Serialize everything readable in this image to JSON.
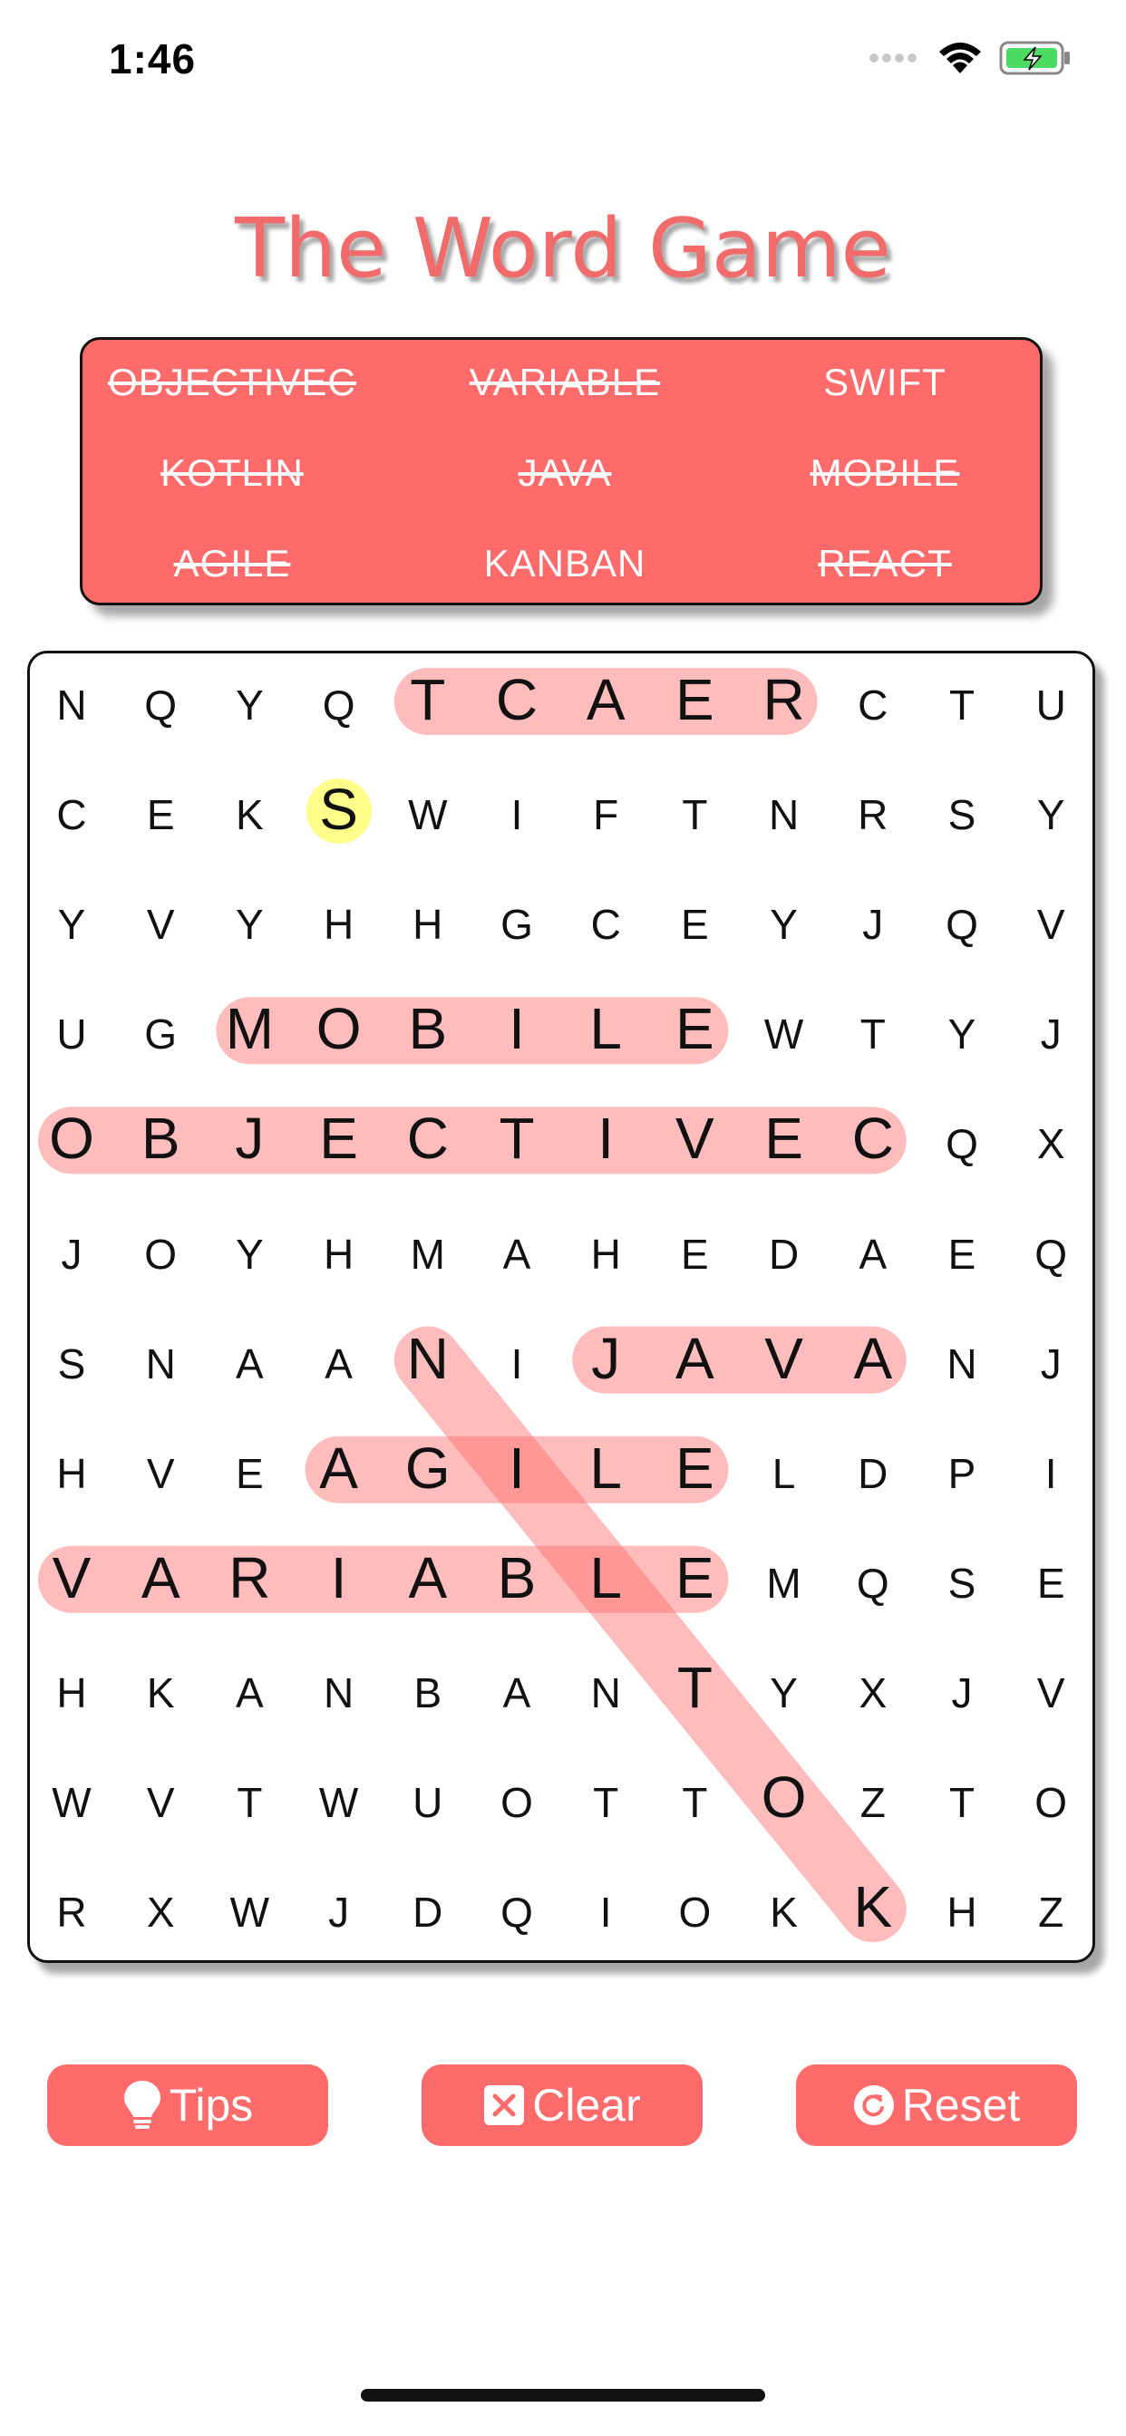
{
  "status": {
    "time": "1:46",
    "icons": [
      "signal-icon",
      "wifi-icon",
      "battery-charging-icon"
    ],
    "battery_color": "#4cd964"
  },
  "title": "The Word Game",
  "colors": {
    "accent": "#ff6b6b",
    "title": "#f26b6b",
    "highlight": "rgba(255,107,107,0.45)",
    "hint": "#ffff8a"
  },
  "words": [
    {
      "label": "OBJECTIVEC",
      "found": true
    },
    {
      "label": "VARIABLE",
      "found": true
    },
    {
      "label": "SWIFT",
      "found": false
    },
    {
      "label": "KOTLIN",
      "found": true
    },
    {
      "label": "JAVA",
      "found": true
    },
    {
      "label": "MOBILE",
      "found": true
    },
    {
      "label": "AGILE",
      "found": true
    },
    {
      "label": "KANBAN",
      "found": false
    },
    {
      "label": "REACT",
      "found": true
    }
  ],
  "grid": [
    [
      "N",
      "Q",
      "Y",
      "Q",
      "T",
      "C",
      "A",
      "E",
      "R",
      "C",
      "T",
      "U"
    ],
    [
      "C",
      "E",
      "K",
      "S",
      "W",
      "I",
      "F",
      "T",
      "N",
      "R",
      "S",
      "Y"
    ],
    [
      "Y",
      "V",
      "Y",
      "H",
      "H",
      "G",
      "C",
      "E",
      "Y",
      "J",
      "Q",
      "V"
    ],
    [
      "U",
      "G",
      "M",
      "O",
      "B",
      "I",
      "L",
      "E",
      "W",
      "T",
      "Y",
      "J"
    ],
    [
      "O",
      "B",
      "J",
      "E",
      "C",
      "T",
      "I",
      "V",
      "E",
      "C",
      "Q",
      "X"
    ],
    [
      "J",
      "O",
      "Y",
      "H",
      "M",
      "A",
      "H",
      "E",
      "D",
      "A",
      "E",
      "Q"
    ],
    [
      "S",
      "N",
      "A",
      "A",
      "N",
      "I",
      "J",
      "A",
      "V",
      "A",
      "N",
      "J"
    ],
    [
      "H",
      "V",
      "E",
      "A",
      "G",
      "I",
      "L",
      "E",
      "L",
      "D",
      "P",
      "I"
    ],
    [
      "V",
      "A",
      "R",
      "I",
      "A",
      "B",
      "L",
      "E",
      "M",
      "Q",
      "S",
      "E"
    ],
    [
      "H",
      "K",
      "A",
      "N",
      "B",
      "A",
      "N",
      "T",
      "Y",
      "X",
      "J",
      "V"
    ],
    [
      "W",
      "V",
      "T",
      "W",
      "U",
      "O",
      "T",
      "T",
      "O",
      "Z",
      "T",
      "O"
    ],
    [
      "R",
      "X",
      "W",
      "J",
      "D",
      "Q",
      "I",
      "O",
      "K",
      "K",
      "H",
      "Z"
    ]
  ],
  "found_paths": [
    {
      "word": "REACT",
      "start": [
        0,
        8
      ],
      "end": [
        0,
        4
      ]
    },
    {
      "word": "MOBILE",
      "start": [
        3,
        2
      ],
      "end": [
        3,
        7
      ]
    },
    {
      "word": "OBJECTIVEC",
      "start": [
        4,
        0
      ],
      "end": [
        4,
        9
      ]
    },
    {
      "word": "JAVA",
      "start": [
        6,
        6
      ],
      "end": [
        6,
        9
      ]
    },
    {
      "word": "AGILE",
      "start": [
        7,
        3
      ],
      "end": [
        7,
        7
      ]
    },
    {
      "word": "VARIABLE",
      "start": [
        8,
        0
      ],
      "end": [
        8,
        7
      ]
    },
    {
      "word": "KOTLIN",
      "start": [
        11,
        9
      ],
      "end": [
        6,
        4
      ]
    }
  ],
  "hint_cell": [
    1,
    3
  ],
  "buttons": {
    "tips": "Tips",
    "clear": "Clear",
    "reset": "Reset"
  }
}
